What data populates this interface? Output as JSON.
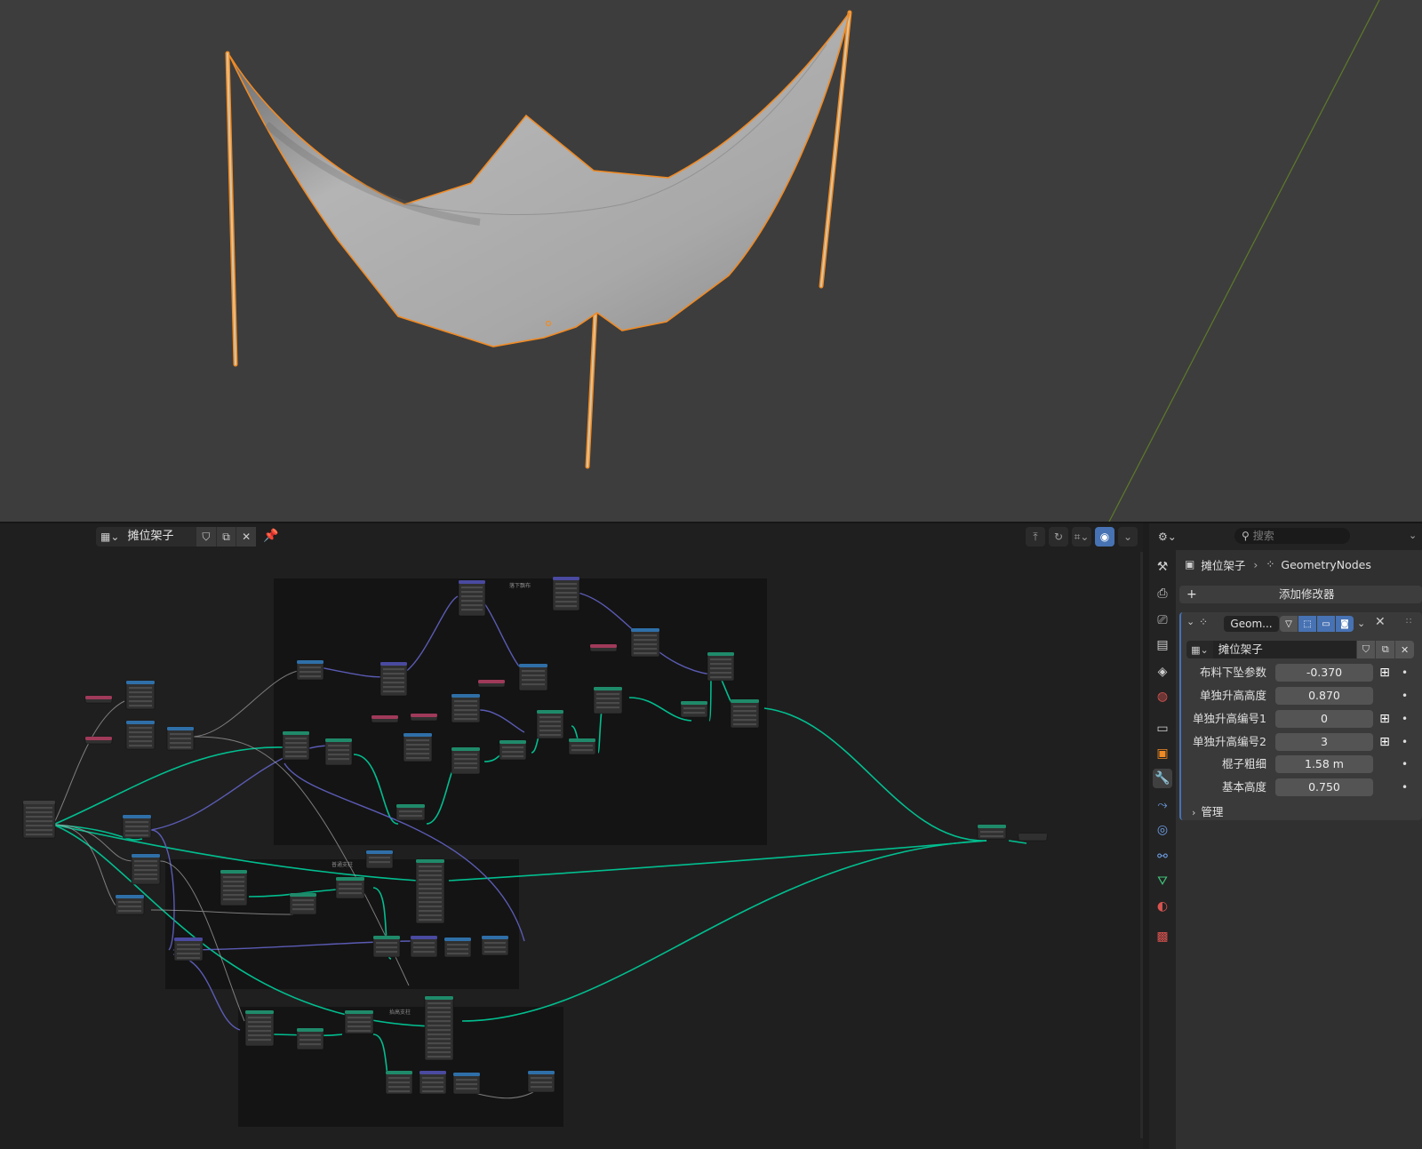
{
  "node_editor": {
    "tree_name": "摊位架子",
    "frames": [
      {
        "label": "落下飘布"
      },
      {
        "label": "普通支柱"
      },
      {
        "label": "抬高支柱"
      }
    ]
  },
  "properties": {
    "search_placeholder": "搜索",
    "breadcrumb": {
      "object": "摊位架子",
      "modifier": "GeometryNodes"
    },
    "add_modifier": "添加修改器",
    "modifier": {
      "name": "Geom...",
      "node_group": "摊位架子",
      "params": [
        {
          "label": "布料下坠参数",
          "value": "-0.370",
          "has_toggle": true
        },
        {
          "label": "单独升高高度",
          "value": "0.870",
          "has_toggle": false
        },
        {
          "label": "单独升高编号1",
          "value": "0",
          "has_toggle": true
        },
        {
          "label": "单独升高编号2",
          "value": "3",
          "has_toggle": true
        },
        {
          "label": "棍子粗细",
          "value": "1.58 m",
          "has_toggle": false
        },
        {
          "label": "基本高度",
          "value": "0.750",
          "has_toggle": false
        }
      ],
      "manage": "管理"
    },
    "tabs": [
      "tool-icon",
      "render-icon",
      "output-icon",
      "view-layer-icon",
      "scene-icon",
      "world-icon",
      "collection-icon",
      "object-icon",
      "modifier-icon",
      "particles-icon",
      "physics-icon",
      "constraints-icon",
      "data-icon",
      "material-icon",
      "texture-icon"
    ]
  },
  "colors": {
    "selection_orange": "#f08a24",
    "geometry_link": "#00c896",
    "vector_link": "#6363c7",
    "active_blue": "#4772b3"
  }
}
